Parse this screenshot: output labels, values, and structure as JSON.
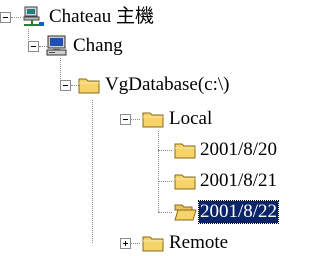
{
  "tree": {
    "host": {
      "label": "Chateau 主機",
      "icon": "network-computer-icon",
      "expanded": true
    },
    "computer": {
      "label": "Chang",
      "icon": "computer-icon",
      "expanded": true
    },
    "database": {
      "label": "VgDatabase(c:\\)",
      "icon": "folder-icon",
      "expanded": true
    },
    "local": {
      "label": "Local",
      "icon": "folder-icon",
      "expanded": true
    },
    "dates": [
      {
        "label": "2001/8/20",
        "icon": "folder-icon",
        "selected": false
      },
      {
        "label": "2001/8/21",
        "icon": "folder-icon",
        "selected": false
      },
      {
        "label": "2001/8/22",
        "icon": "open-folder-icon",
        "selected": true
      }
    ],
    "remote": {
      "label": "Remote",
      "icon": "folder-icon",
      "expanded": false
    }
  },
  "colors": {
    "selection": "#0a246a",
    "selection_text": "#ffffff",
    "folder": "#f6d46a",
    "folder_border": "#8a6a1a",
    "guide": "#8a8a8a"
  }
}
